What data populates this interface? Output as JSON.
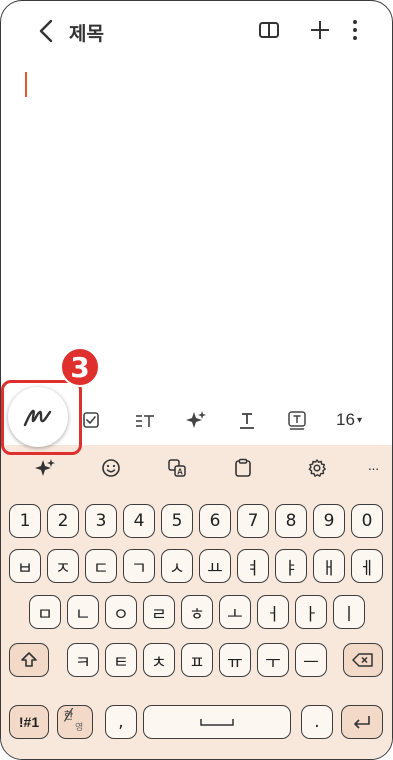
{
  "header": {
    "title": "제목",
    "back_icon": "chevron-left-icon",
    "book_icon": "book-icon",
    "add_icon": "plus-icon",
    "more_icon": "more-vertical-icon"
  },
  "step_badge": "3",
  "format_toolbar": {
    "items": [
      "pen-icon",
      "checkbox-icon",
      "text-style-icon",
      "ai-sparkle-icon",
      "underline-text-icon",
      "text-box-icon"
    ],
    "font_size": "16",
    "font_size_caret": "▾"
  },
  "keyboard_toolbar": {
    "items": [
      "ai-sparkle-icon",
      "emoji-icon",
      "translate-icon",
      "clipboard-icon",
      "settings-icon",
      "more-horizontal-icon"
    ],
    "more_label": "···"
  },
  "keyboard": {
    "row1": [
      "1",
      "2",
      "3",
      "4",
      "5",
      "6",
      "7",
      "8",
      "9",
      "0"
    ],
    "row2": [
      "ㅂ",
      "ㅈ",
      "ㄷ",
      "ㄱ",
      "ㅅ",
      "ㅛ",
      "ㅕ",
      "ㅑ",
      "ㅐ",
      "ㅔ"
    ],
    "row3": [
      "ㅁ",
      "ㄴ",
      "ㅇ",
      "ㄹ",
      "ㅎ",
      "ㅗ",
      "ㅓ",
      "ㅏ",
      "ㅣ"
    ],
    "row4": [
      "ㅋ",
      "ㅌ",
      "ㅊ",
      "ㅍ",
      "ㅠ",
      "ㅜ",
      "ㅡ"
    ],
    "symbols_label": "!#1",
    "lang_top": "한",
    "lang_bottom": "영",
    "comma": ",",
    "period": "."
  },
  "colors": {
    "accent": "#e0302d",
    "keyboard_bg": "#f8e8dc",
    "key_bg": "#fdf7f2",
    "special_key_bg": "#f3d9c7",
    "cursor": "#e25a2c"
  }
}
